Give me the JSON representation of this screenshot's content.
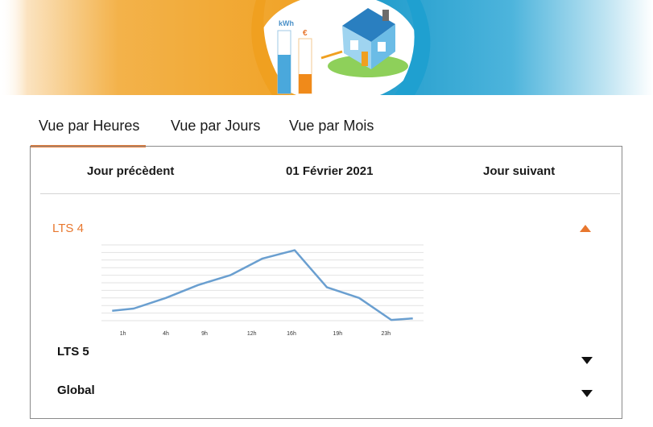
{
  "banner": {
    "kwh_label": "kWh",
    "euro_label": "€",
    "colors": {
      "orange": "#f0a020",
      "blue": "#1fa0d0"
    }
  },
  "tabs": [
    {
      "label": "Vue par Heures",
      "active": true
    },
    {
      "label": "Vue par Jours",
      "active": false
    },
    {
      "label": "Vue par Mois",
      "active": false
    }
  ],
  "nav": {
    "prev_label": "Jour précèdent",
    "date_label": "01  Février 2021",
    "next_label": "Jour suivant"
  },
  "sections": [
    {
      "label": "LTS 4",
      "expanded": true,
      "toggle_icon": "triangle-up-icon"
    },
    {
      "label": "LTS 5",
      "expanded": false,
      "toggle_icon": "triangle-down-icon"
    },
    {
      "label": "Global",
      "expanded": false,
      "toggle_icon": "triangle-down-icon"
    }
  ],
  "chart_data": {
    "type": "line",
    "x": [
      1,
      3,
      6,
      9,
      12,
      15,
      18,
      21,
      24,
      27,
      29
    ],
    "y": [
      1.3,
      1.6,
      3.0,
      4.7,
      6.0,
      8.2,
      9.3,
      4.4,
      3.0,
      0.1,
      0.3
    ],
    "x_tick_labels": [
      "1h",
      "4h",
      "9h",
      "12h",
      "16h",
      "19h",
      "23h"
    ],
    "ylim": [
      0,
      10
    ],
    "grid": true,
    "line_color": "#6a9fd0",
    "title": "",
    "xlabel": "",
    "ylabel": ""
  }
}
